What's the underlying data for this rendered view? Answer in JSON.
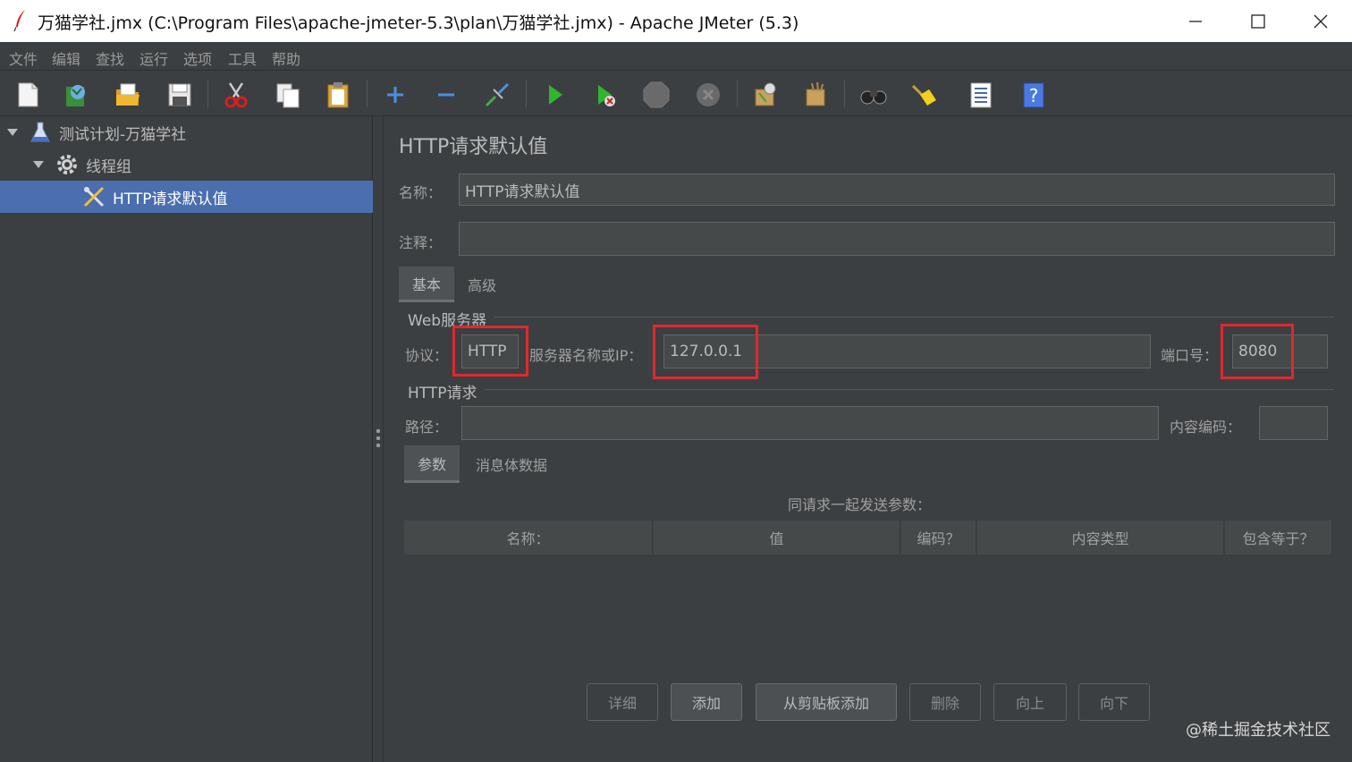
{
  "window": {
    "title": "万猫学社.jmx (C:\\Program Files\\apache-jmeter-5.3\\plan\\万猫学社.jmx) - Apache JMeter (5.3)"
  },
  "menu": [
    "文件",
    "编辑",
    "查找",
    "运行",
    "选项",
    "工具",
    "帮助"
  ],
  "toolbar": [
    {
      "icon": "new-icon"
    },
    {
      "icon": "templates-icon"
    },
    {
      "icon": "open-icon"
    },
    {
      "icon": "save-icon"
    },
    {
      "icon": "cut-icon"
    },
    {
      "icon": "copy-icon"
    },
    {
      "icon": "paste-icon"
    },
    {
      "icon": "expand-icon"
    },
    {
      "icon": "collapse-icon"
    },
    {
      "icon": "toggle-icon"
    },
    {
      "icon": "start-icon"
    },
    {
      "icon": "start-no-pauses-icon"
    },
    {
      "icon": "stop-icon"
    },
    {
      "icon": "shutdown-icon"
    },
    {
      "icon": "remote-start-icon"
    },
    {
      "icon": "remote-stop-icon"
    },
    {
      "icon": "search-icon"
    },
    {
      "icon": "clear-all-icon"
    },
    {
      "icon": "function-helper-icon"
    },
    {
      "icon": "help-icon"
    }
  ],
  "tree": {
    "test_plan": "测试计划-万猫学社",
    "thread_group": "线程组",
    "http_defaults": "HTTP请求默认值"
  },
  "panel": {
    "title": "HTTP请求默认值",
    "name_label": "名称：",
    "name_value": "HTTP请求默认值",
    "comment_label": "注释：",
    "comment_value": "",
    "tabs": [
      "基本",
      "高级"
    ],
    "web_server_title": "Web服务器",
    "protocol_label": "协议：",
    "protocol_value": "HTTP",
    "server_label": "服务器名称或IP：",
    "server_value": "127.0.0.1",
    "port_label": "端口号：",
    "port_value": "8080",
    "http_request_title": "HTTP请求",
    "path_label": "路径：",
    "path_value": "",
    "encoding_label": "内容编码：",
    "encoding_value": "",
    "subtabs": [
      "参数",
      "消息体数据"
    ],
    "params_caption": "同请求一起发送参数：",
    "columns": [
      "名称：",
      "值",
      "编码？",
      "内容类型",
      "包含等于？"
    ],
    "buttons": [
      "详细",
      "添加",
      "从剪贴板添加",
      "删除",
      "向上",
      "向下"
    ]
  },
  "watermark": "@稀土掘金技术社区",
  "colors": {
    "background": "#3c3f41",
    "selection": "#4b6eaf",
    "highlight": "#e0282d"
  }
}
